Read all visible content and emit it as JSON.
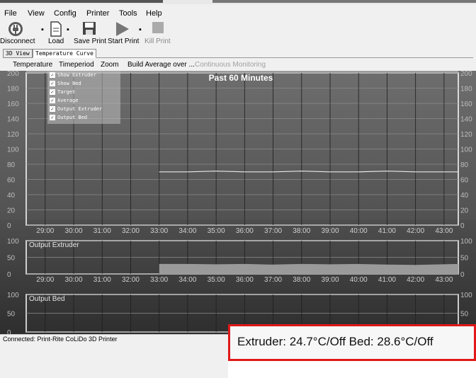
{
  "menu": [
    "File",
    "View",
    "Config",
    "Printer",
    "Tools",
    "Help"
  ],
  "toolbar": {
    "disconnect": "Disconnect",
    "load": "Load",
    "save_print": "Save Print",
    "start_print": "Start Print",
    "kill_print": "Kill Print"
  },
  "tabs": [
    "3D View",
    "Temperature Curve"
  ],
  "submenu": [
    "Temperature",
    "Timeperiod",
    "Zoom",
    "Build Average over ...",
    "Continuous Monitoring"
  ],
  "legend": [
    "Show Extruder",
    "Show Bed",
    "Target",
    "Average",
    "Output Extruder",
    "Output Bed"
  ],
  "chart_data": {
    "type": "line",
    "title": "Past 60 Minutes",
    "x_ticks": [
      "29:00",
      "30:00",
      "31:00",
      "32:00",
      "33:00",
      "34:00",
      "35:00",
      "36:00",
      "37:00",
      "38:00",
      "39:00",
      "40:00",
      "41:00",
      "42:00",
      "43:00"
    ],
    "panels": [
      {
        "name": "temperature",
        "ylim": [
          0,
          200
        ],
        "y_ticks": [
          0,
          20,
          40,
          60,
          80,
          100,
          120,
          140,
          160,
          180,
          200
        ],
        "series": [
          {
            "color": "#e8e8e8",
            "x": [
              "33:00",
              "34:00",
              "35:00",
              "36:00",
              "37:00",
              "38:00",
              "39:00",
              "40:00",
              "41:00",
              "42:00",
              "43:30"
            ],
            "values": [
              70,
              70,
              71,
              70,
              70,
              71,
              70,
              70,
              71,
              70,
              70
            ]
          },
          {
            "color": "#bdbdbd",
            "x": [
              "28:20",
              "43:30"
            ],
            "values": [
              202,
              202
            ]
          }
        ]
      },
      {
        "name": "output-extruder",
        "title": "Output Extruder",
        "ylim": [
          0,
          100
        ],
        "y_ticks": [
          0,
          50,
          100
        ],
        "series": [
          {
            "color": "#9a9a9a",
            "x": [
              "33:00",
              "34:00",
              "35:00",
              "36:00",
              "37:00",
              "38:00",
              "39:00",
              "40:00",
              "41:00",
              "42:00",
              "43:30"
            ],
            "values": [
              30,
              30,
              29,
              30,
              28,
              30,
              29,
              30,
              28,
              27,
              30
            ]
          }
        ]
      },
      {
        "name": "output-bed",
        "title": "Output Bed",
        "ylim": [
          0,
          100
        ],
        "y_ticks": [
          0,
          50,
          100
        ],
        "series": []
      }
    ]
  },
  "status": "Connected: Print-Rite CoLiDo 3D Printer",
  "temperature_readout": "Extruder: 24.7°C/Off Bed: 28.6°C/Off"
}
